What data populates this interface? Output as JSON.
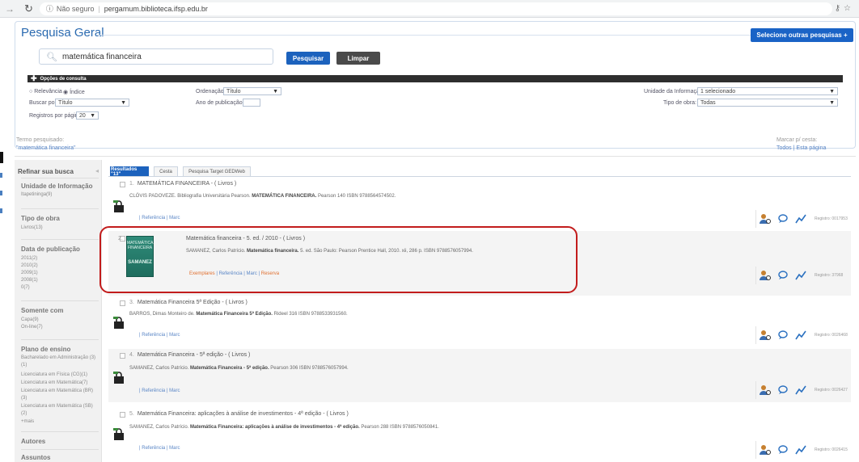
{
  "browser": {
    "security": "Não seguro",
    "url": "pergamum.biblioteca.ifsp.edu.br"
  },
  "header": {
    "title": "Pesquisa Geral",
    "other_searches_button": "Selecione outras pesquisas"
  },
  "search": {
    "query": "matemática financeira",
    "search_button": "Pesquisar",
    "clear_button": "Limpar"
  },
  "options": {
    "bar_label": "Opções de consulta",
    "radio_relevance": "Relevância",
    "radio_index": "Índice",
    "search_by_label": "Buscar por:",
    "search_by_value": "Título",
    "per_page_label": "Registros por página:",
    "per_page_value": "20",
    "order_label": "Ordenação:",
    "order_value": "Título",
    "pub_year_label": "Ano de publicação:",
    "unit_label": "Unidade da Informação:",
    "unit_value": "1 selecionado",
    "work_type_label": "Tipo de obra:",
    "work_type_value": "Todas"
  },
  "terms": {
    "label": "Termo pesquisado:",
    "value": "\"matemática financeira\"",
    "mark_label": "Marcar p/ cesta:",
    "mark_all": "Todos",
    "mark_page": "Esta página"
  },
  "sidebar": {
    "title": "Refinar sua busca",
    "facets": [
      {
        "title": "Unidade de Informação",
        "items": [
          "Itapetininga(9)"
        ]
      },
      {
        "title": "Tipo de obra",
        "items": [
          "Livros(13)"
        ]
      },
      {
        "title": "Data de publicação",
        "items": [
          "2011(2)",
          "2010(2)",
          "2009(1)",
          "2008(1)",
          "0(7)"
        ]
      },
      {
        "title": "Somente com",
        "items": [
          "Capa(9)",
          "On-line(7)"
        ]
      },
      {
        "title": "Plano de ensino",
        "items": [
          "Bacharelado em Administração (3)(1)",
          "Licenciatura em Física (CG)(1)",
          "Licenciatura em Matemática(7)",
          "Licenciatura em Matemática (BR)(3)",
          "Licenciatura em Matemática (SB)(2)",
          "+mais"
        ]
      },
      {
        "title": "Autores",
        "items": []
      },
      {
        "title": "Assuntos",
        "items": []
      }
    ]
  },
  "tabs": [
    "Resultados \"13\"",
    "Cesta",
    "Pesquisa Target GEDWeb"
  ],
  "results": [
    {
      "num": "1.",
      "title": "MATEMÁTICA FINANCEIRA - ( Livros )",
      "desc_pre": "CLÓVIS PADOVEZE. Bibliografia Universitária Pearson.",
      "desc_bold": "MATEMÁTICA FINANCEIRA.",
      "desc_post": "Pearson 140 ISBN 9788564574502.",
      "links": [
        "Referência",
        "Marc"
      ],
      "reg": "Registro: 0017953"
    },
    {
      "num": "2.",
      "title": "Matemática financeira - 5. ed. / 2010 - ( Livros )",
      "desc_pre": "SAMANEZ, Carlos Patrício.",
      "desc_bold": "Matemática financeira.",
      "desc_post": "5. ed. São Paulo: Pearson Prentice Hall, 2010. xii, 286 p. ISBN 9788576057994.",
      "links_orange": [
        "Exemplares",
        "Reserva"
      ],
      "links": [
        "Exemplares",
        "Referência",
        "Marc",
        "Reserva"
      ],
      "reg": "Registro: 37968",
      "cover_text": "MATEMÁTICA FINANCEIRA",
      "cover_author": "SAMANEZ"
    },
    {
      "num": "3.",
      "title": "Matemática Financeira 5ª Edição - ( Livros )",
      "desc_pre": "BARROS, Dimas Monteiro de.",
      "desc_bold": "Matemática Financeira 5ª Edição.",
      "desc_post": "Rideel 316 ISBN 9788533931560.",
      "links": [
        "Referência",
        "Marc"
      ],
      "reg": "Registro: 0026468"
    },
    {
      "num": "4.",
      "title": "Matemática Financeira - 5ª edição - ( Livros )",
      "desc_pre": "SAMANEZ, Carlos Patrício.",
      "desc_bold": "Matemática Financeira - 5ª edição.",
      "desc_post": "Pearson 306 ISBN 9788576057994.",
      "links": [
        "Referência",
        "Marc"
      ],
      "reg": "Registro: 0026427"
    },
    {
      "num": "5.",
      "title": "Matemática Financeira: aplicações à análise de investimentos - 4ª edição - ( Livros )",
      "desc_pre": "SAMANEZ, Carlos Patrício.",
      "desc_bold": "Matemática Financeira: aplicações à análise de investimentos - 4ª edição.",
      "desc_post": "Pearson 288 ISBN 9788576050841.",
      "links": [
        "Referência",
        "Marc"
      ],
      "reg": "Registro: 0026415"
    }
  ],
  "colors": {
    "accent": "#1c62bd",
    "highlight": "#c21c1c"
  }
}
